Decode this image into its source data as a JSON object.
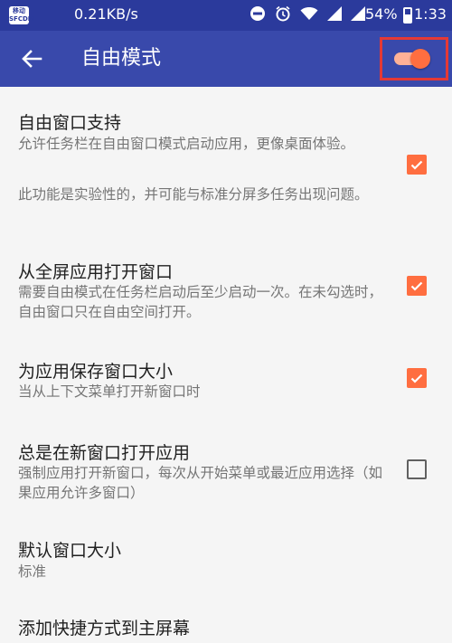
{
  "statusbar": {
    "logo": "移动\nSFCDM",
    "speed": "0.21KB/s",
    "battery": "54%",
    "battery_level": 0.54,
    "time": "1:33",
    "icons": [
      "do-not-disturb-icon",
      "alarm-icon",
      "wifi-icon",
      "signal-icon",
      "signal-icon"
    ]
  },
  "toolbar": {
    "title": "自由模式",
    "toggle_on": true,
    "accent": "#ff6e40"
  },
  "prefs": [
    {
      "title": "自由窗口支持",
      "summary": "允许任务栏在自由窗口模式启动应用，更像桌面体验。",
      "summary2": "此功能是实验性的，并可能与标准分屏多任务出现问题。",
      "checked": true
    },
    {
      "title": "从全屏应用打开窗口",
      "summary": "需要自由模式在任务栏启动后至少启动一次。在未勾选时，自由窗口只在自由空间打开。",
      "checked": true
    },
    {
      "title": "为应用保存窗口大小",
      "summary": "当从上下文菜单打开新窗口时",
      "checked": true
    },
    {
      "title": "总是在新窗口打开应用",
      "summary": "强制应用打开新窗口，每次从开始菜单或最近应用选择（如果应用允许多窗口）",
      "checked": false
    },
    {
      "title": "默认窗口大小",
      "summary": "标准"
    },
    {
      "title": "添加快捷方式到主屏幕"
    }
  ],
  "colors": {
    "statusbar": "#2b3a9c",
    "toolbar": "#3949ab",
    "highlight": "#e53935"
  }
}
